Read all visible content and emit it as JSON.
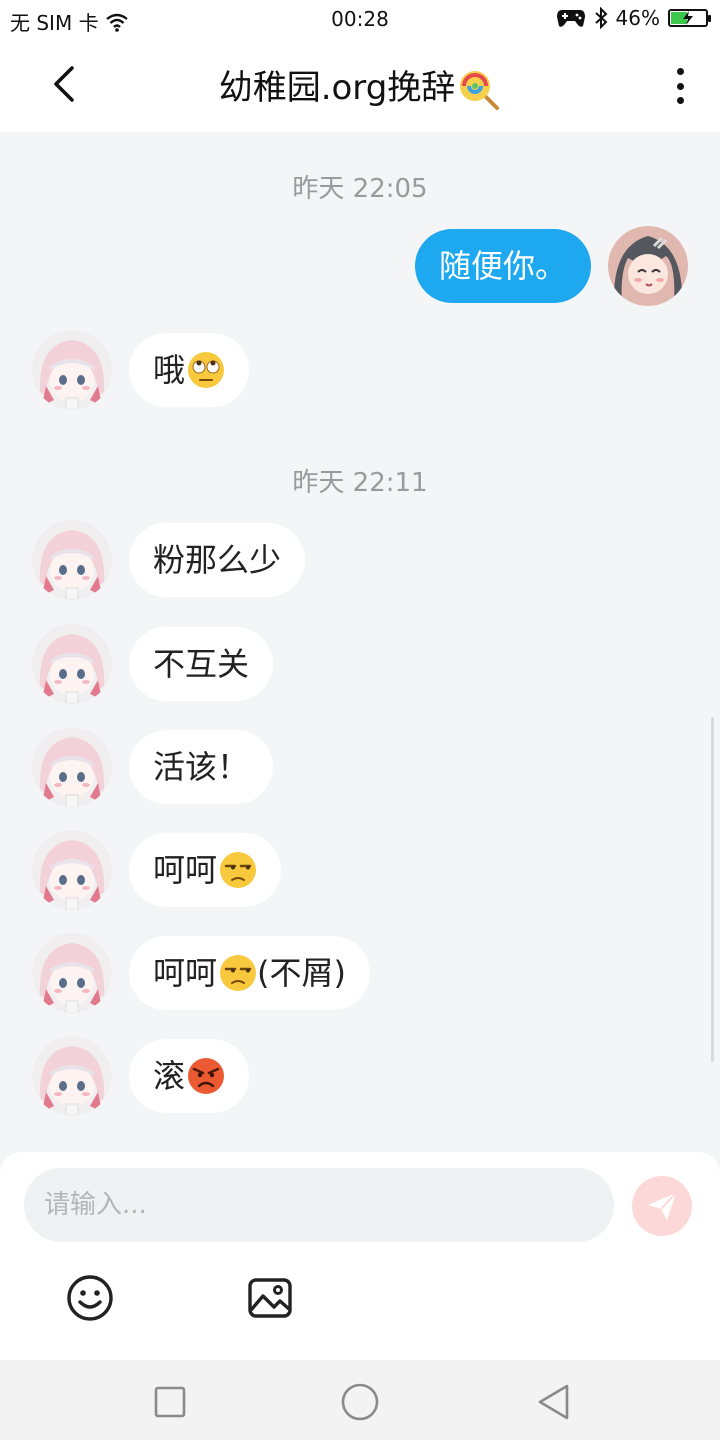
{
  "status_bar": {
    "carrier": "无 SIM 卡",
    "time": "00:28",
    "battery_pct": "46%",
    "battery_level": 0.46,
    "battery_color": "#3cc84a"
  },
  "header": {
    "title": "幼稚园.org挽辞",
    "title_icon": "lollipop-emoji",
    "back_icon": "chevron-left-icon",
    "more_icon": "more-vertical-icon"
  },
  "chat": {
    "timestamps": [
      "昨天 22:05",
      "昨天 22:11"
    ],
    "messages": [
      {
        "side": "right",
        "text": "随便你。",
        "emoji": ""
      },
      {
        "side": "left",
        "text": "哦",
        "emoji": "eye-roll-emoji"
      },
      {
        "side": "left",
        "text": "粉那么少",
        "emoji": ""
      },
      {
        "side": "left",
        "text": "不互关",
        "emoji": ""
      },
      {
        "side": "left",
        "text": "活该！",
        "emoji": ""
      },
      {
        "side": "left",
        "text": "呵呵",
        "emoji": "unamused-emoji"
      },
      {
        "side": "left",
        "text": "呵呵",
        "emoji": "unamused-emoji",
        "suffix": "(不屑)"
      },
      {
        "side": "left",
        "text": "滚",
        "emoji": "angry-emoji"
      }
    ]
  },
  "composer": {
    "placeholder": "请输入...",
    "send_icon": "send-icon",
    "emoji_icon": "smiley-icon",
    "image_icon": "image-icon"
  },
  "nav": {
    "icons": [
      "square-icon",
      "circle-icon",
      "triangle-back-icon"
    ]
  },
  "colors": {
    "my_bubble": "#1ea8f0",
    "background": "#f4f5f7",
    "send_button": "#fcd8d8"
  }
}
